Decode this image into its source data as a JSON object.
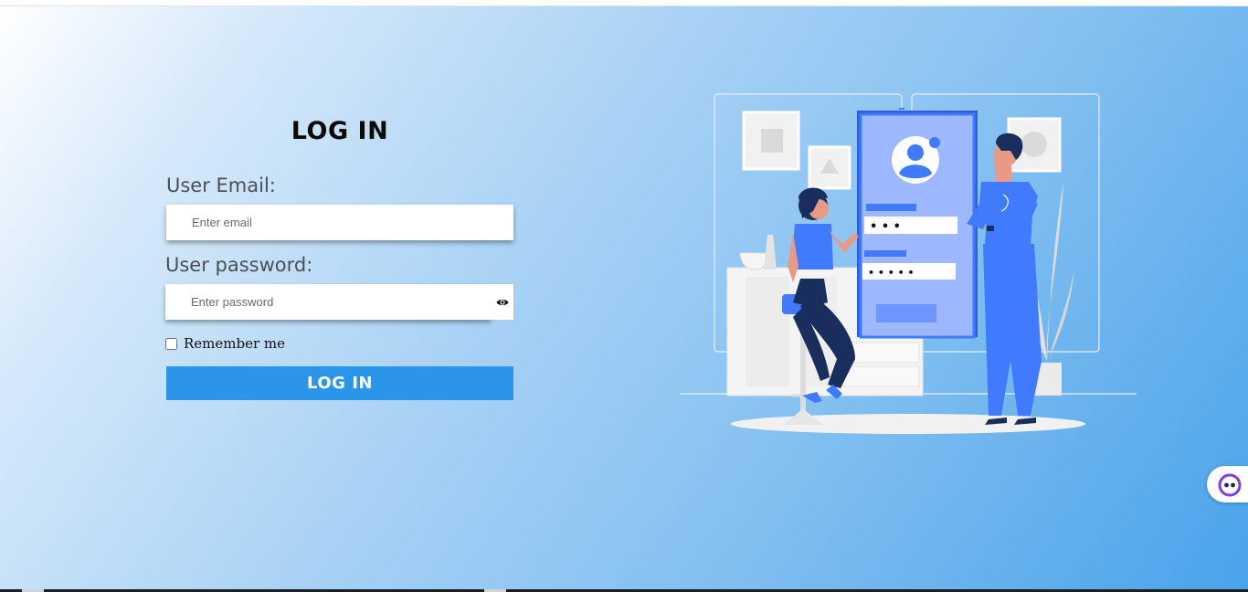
{
  "form": {
    "title": "LOG IN",
    "email_label": "User Email:",
    "email_placeholder": "Enter email",
    "email_value": "",
    "password_label": "User password:",
    "password_placeholder": "Enter password",
    "password_value": "",
    "remember_label": "Remember me",
    "remember_checked": false,
    "submit_label": "LOG IN"
  },
  "illustration": {
    "phone_dots_1": "• • •",
    "phone_dots_2": "• • • • •"
  },
  "icons": {
    "password_toggle": "eye-icon",
    "chat": "chat-bot-icon"
  },
  "colors": {
    "accent": "#2b95e9",
    "illustration_blue": "#407bff",
    "text": "#4a4f56"
  }
}
